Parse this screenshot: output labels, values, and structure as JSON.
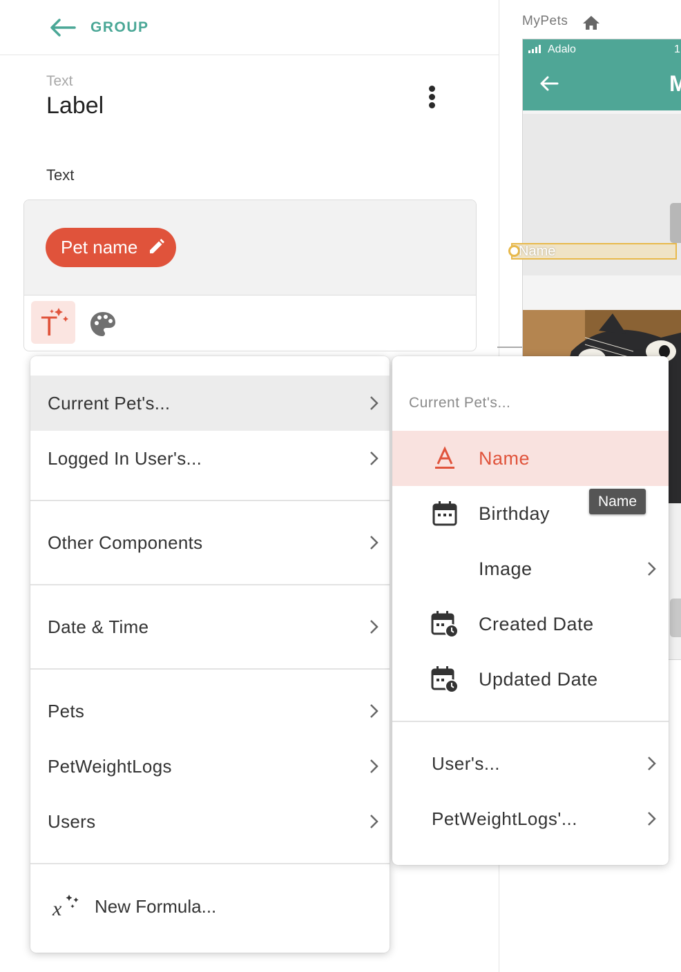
{
  "header": {
    "back_label": "GROUP"
  },
  "component": {
    "type": "Text",
    "name": "Label"
  },
  "text_section": {
    "heading": "Text",
    "chip_label": "Pet name"
  },
  "preview": {
    "app_name": "MyPets",
    "carrier": "Adalo",
    "clock": "1:",
    "screen_title": "M",
    "name_field": "Name"
  },
  "main_menu": {
    "items": [
      {
        "label": "Current Pet's..."
      },
      {
        "label": "Logged In User's..."
      },
      {
        "label": "Other Components"
      },
      {
        "label": "Date & Time"
      },
      {
        "label": "Pets"
      },
      {
        "label": "PetWeightLogs"
      },
      {
        "label": "Users"
      }
    ],
    "formula_label": "New Formula..."
  },
  "sub_menu": {
    "title": "Current Pet's...",
    "items": [
      {
        "label": "Name",
        "icon": "text-a-icon"
      },
      {
        "label": "Birthday",
        "icon": "calendar-icon"
      },
      {
        "label": "Image",
        "icon": "none"
      },
      {
        "label": "Created Date",
        "icon": "calendar-clock-icon"
      },
      {
        "label": "Updated Date",
        "icon": "calendar-clock-icon"
      }
    ],
    "relations": [
      {
        "label": "User's..."
      },
      {
        "label": "PetWeightLogs'..."
      }
    ]
  },
  "tooltip": "Name",
  "colors": {
    "accent": "#4aa796",
    "brand_red": "#e0533b",
    "selected_bg": "#f9e2df",
    "hover_bg": "#ececec"
  }
}
